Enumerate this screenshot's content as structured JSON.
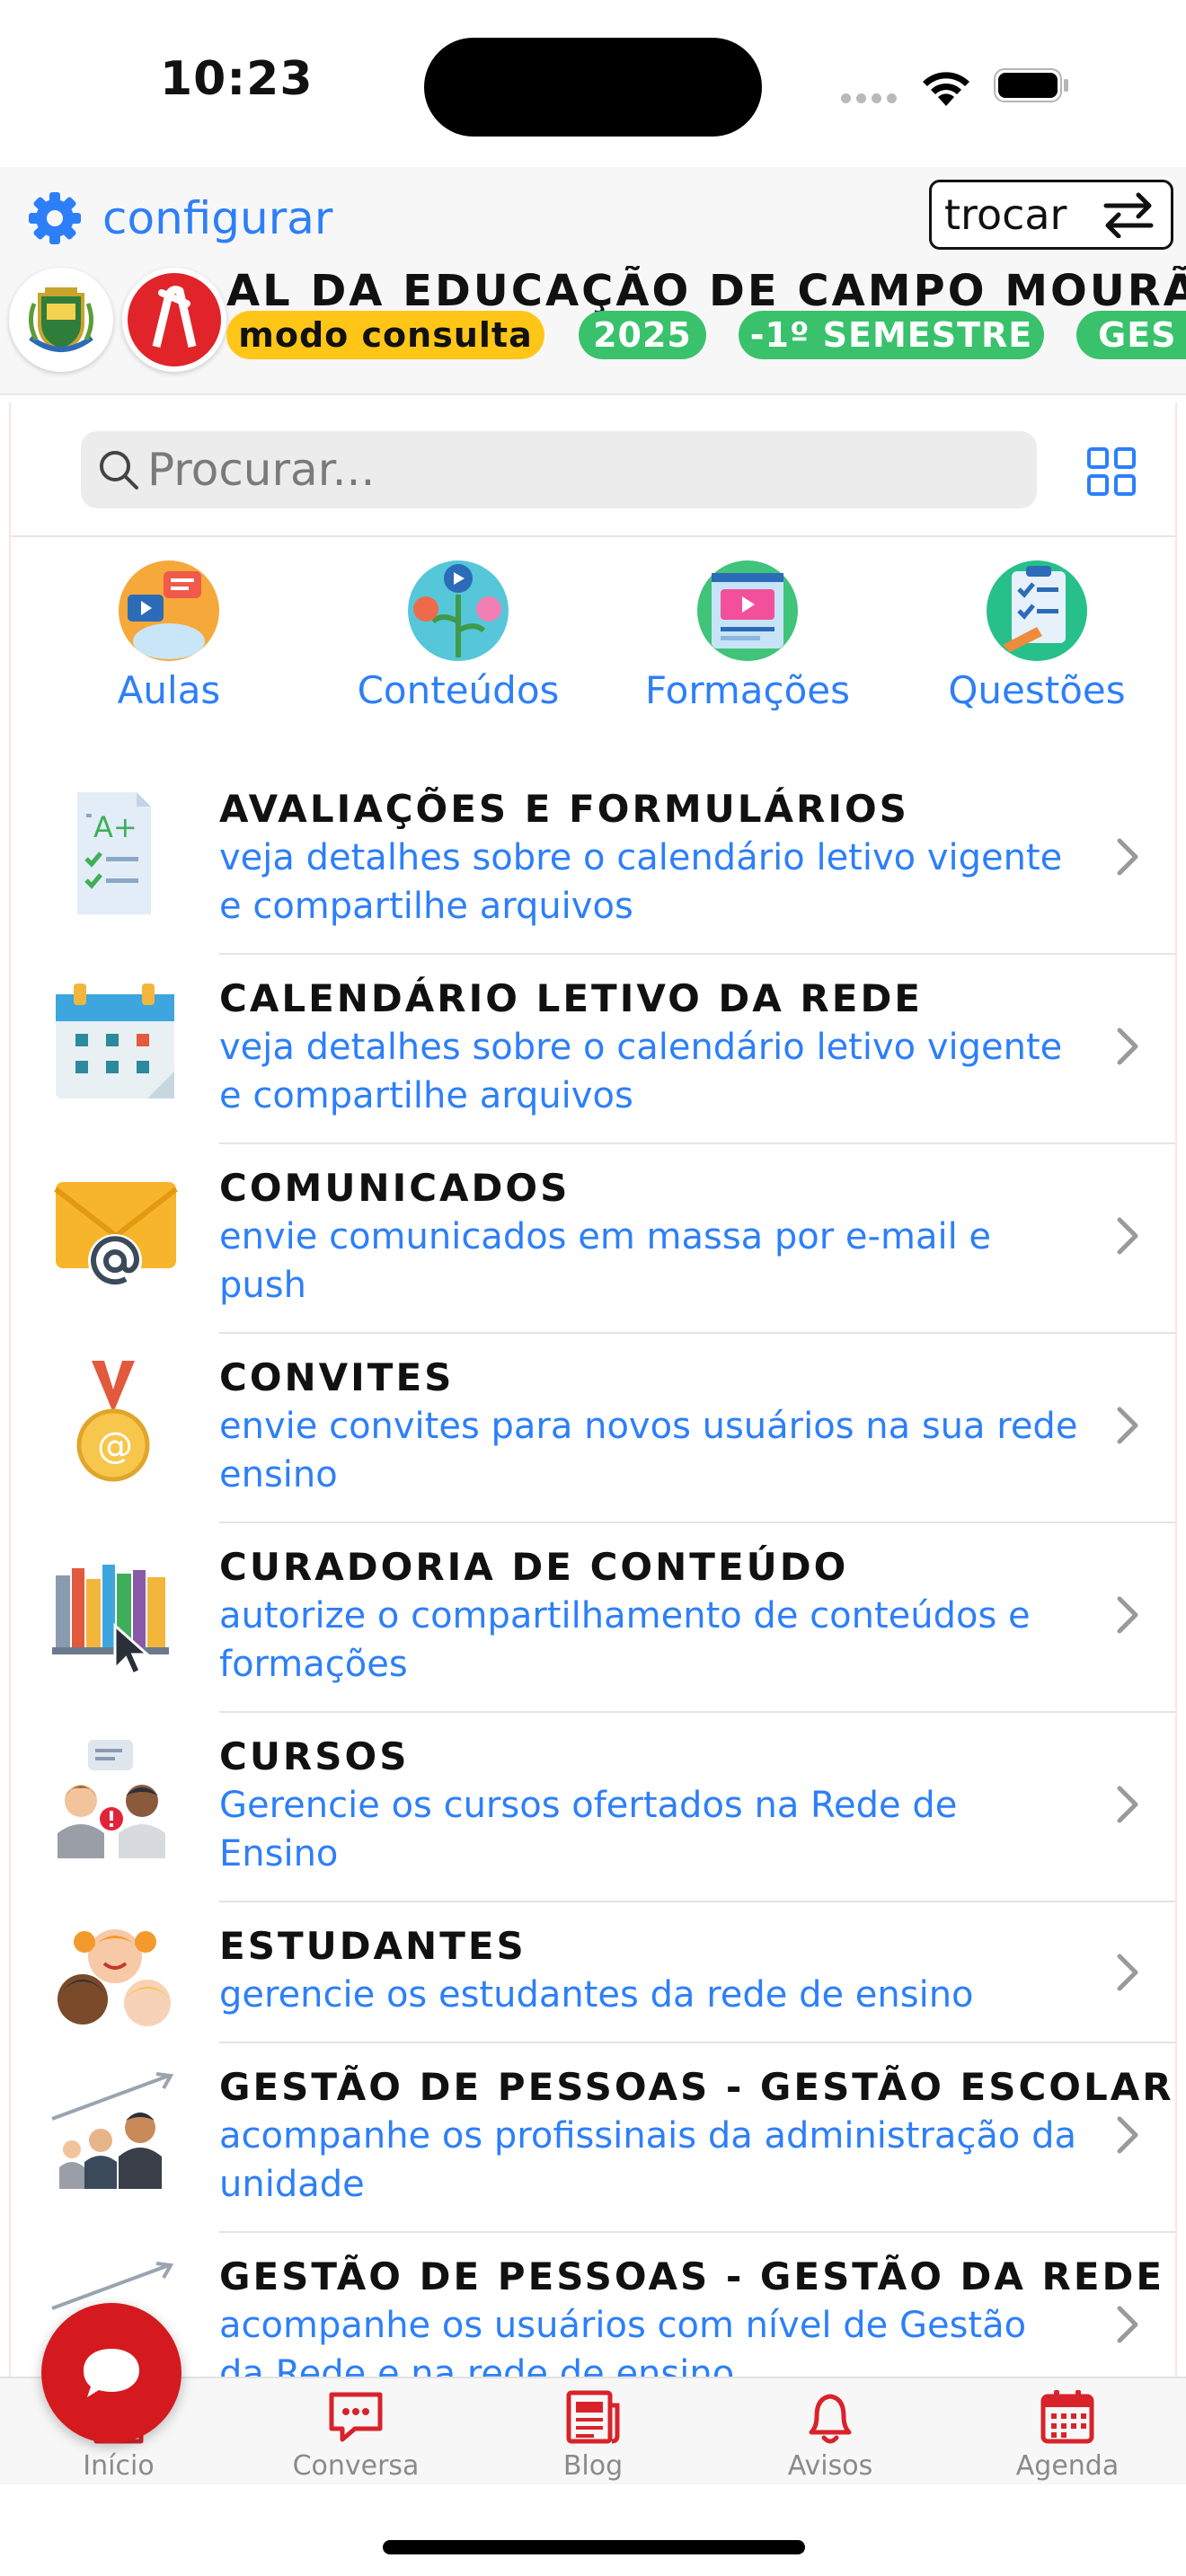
{
  "status": {
    "time": "10:23"
  },
  "header": {
    "config_label": "configurar",
    "switch_label": "trocar",
    "banner_title": "AL DA EDUCAÇÃO DE CAMPO MOURÃO",
    "chips": [
      "modo consulta",
      "2025",
      "-1º SEMESTRE",
      "GES"
    ]
  },
  "search": {
    "placeholder": "Procurar..."
  },
  "shortcuts": [
    {
      "label": "Aulas",
      "icon": "lessons-icon"
    },
    {
      "label": "Conteúdos",
      "icon": "contents-icon"
    },
    {
      "label": "Formações",
      "icon": "trainings-icon"
    },
    {
      "label": "Questões",
      "icon": "questions-icon"
    }
  ],
  "menu": [
    {
      "title": "AVALIAÇÕES E FORMULÁRIOS",
      "desc": "veja detalhes sobre o calendário letivo vigente e compartilhe arquivos"
    },
    {
      "title": "CALENDÁRIO LETIVO DA REDE",
      "desc": "veja detalhes sobre o calendário letivo vigente e compartilhe arquivos"
    },
    {
      "title": "COMUNICADOS",
      "desc": "envie comunicados em massa por e-mail e push"
    },
    {
      "title": "CONVITES",
      "desc": "envie convites para novos usuários na sua rede ensino"
    },
    {
      "title": "CURADORIA DE CONTEÚDO",
      "desc": "autorize o compartilhamento de conteúdos e formações"
    },
    {
      "title": "CURSOS",
      "desc": "Gerencie os cursos ofertados na Rede de Ensino"
    },
    {
      "title": "ESTUDANTES",
      "desc": "gerencie os estudantes da rede de ensino"
    },
    {
      "title": "GESTÃO DE PESSOAS - GESTÃO ESCOLAR",
      "desc": "acompanhe os profissinais da administração da unidade"
    },
    {
      "title": "GESTÃO DE PESSOAS - GESTÃO DA REDE",
      "desc": "acompanhe os usuários com nível de Gestão da Rede e na rede de ensino"
    }
  ],
  "tabs": [
    {
      "label": "Início"
    },
    {
      "label": "Conversa"
    },
    {
      "label": "Blog"
    },
    {
      "label": "Avisos"
    },
    {
      "label": "Agenda"
    }
  ],
  "colors": {
    "accent": "#2d7ff9",
    "brand_red": "#d41a1f",
    "chip_green": "#39c16c",
    "chip_yellow": "#ffc617"
  }
}
